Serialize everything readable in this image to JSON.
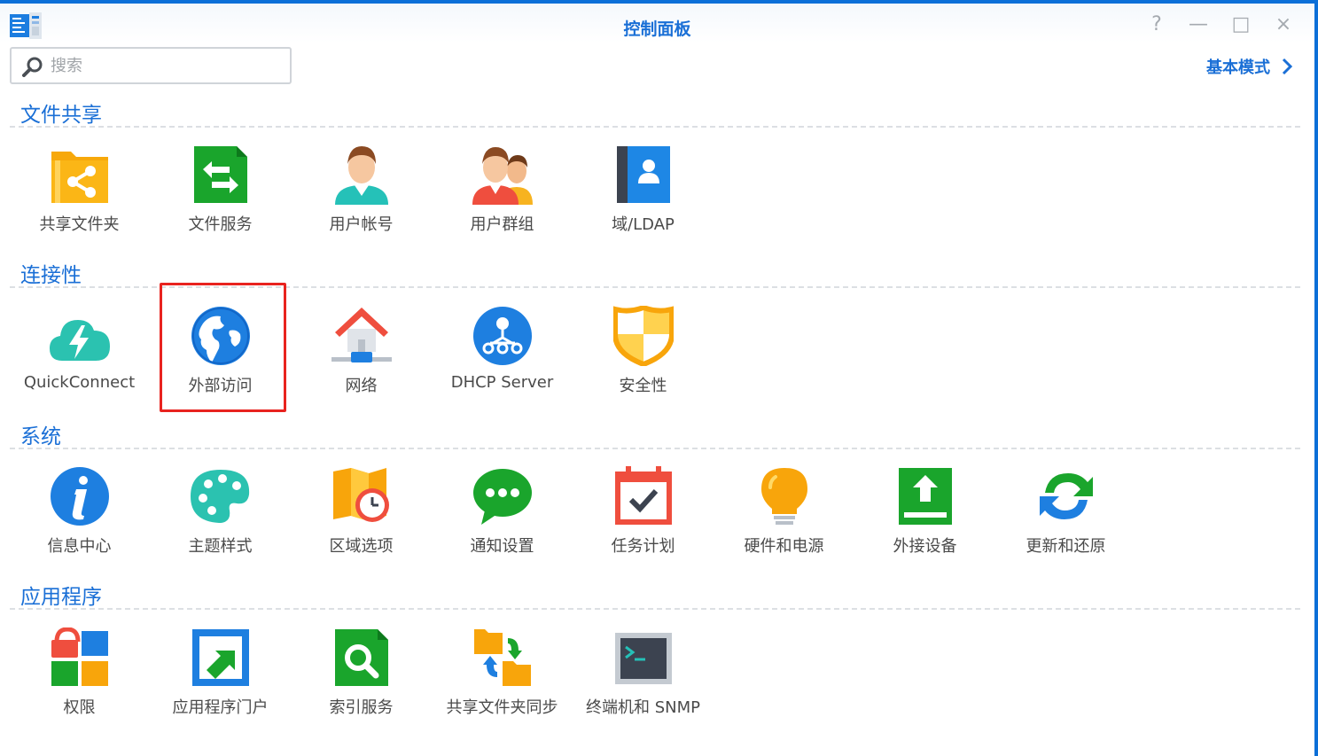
{
  "window": {
    "title": "控制面板",
    "buttons": {
      "help": "?",
      "minimize": "—",
      "maximize": "□",
      "close": "×"
    }
  },
  "search": {
    "placeholder": "搜索",
    "value": ""
  },
  "mode_link": {
    "label": "基本模式"
  },
  "colors": {
    "accent": "#1a6fd6",
    "highlight": "#e8231f",
    "title_bar_stripe": "#0b6fd8"
  },
  "sections": [
    {
      "title": "文件共享",
      "items": [
        {
          "label": "共享文件夹",
          "icon": "shared-folder-icon"
        },
        {
          "label": "文件服务",
          "icon": "file-services-icon"
        },
        {
          "label": "用户帐号",
          "icon": "user-icon"
        },
        {
          "label": "用户群组",
          "icon": "group-icon"
        },
        {
          "label": "域/LDAP",
          "icon": "domain-ldap-icon"
        }
      ]
    },
    {
      "title": "连接性",
      "items": [
        {
          "label": "QuickConnect",
          "icon": "quickconnect-icon"
        },
        {
          "label": "外部访问",
          "icon": "globe-icon",
          "highlighted": true
        },
        {
          "label": "网络",
          "icon": "network-icon"
        },
        {
          "label": "DHCP Server",
          "icon": "dhcp-server-icon"
        },
        {
          "label": "安全性",
          "icon": "shield-icon"
        }
      ]
    },
    {
      "title": "系统",
      "items": [
        {
          "label": "信息中心",
          "icon": "info-icon"
        },
        {
          "label": "主题样式",
          "icon": "palette-icon"
        },
        {
          "label": "区域选项",
          "icon": "regional-options-icon"
        },
        {
          "label": "通知设置",
          "icon": "notification-icon"
        },
        {
          "label": "任务计划",
          "icon": "calendar-task-icon"
        },
        {
          "label": "硬件和电源",
          "icon": "lightbulb-icon"
        },
        {
          "label": "外接设备",
          "icon": "external-device-icon"
        },
        {
          "label": "更新和还原",
          "icon": "update-restore-icon"
        }
      ]
    },
    {
      "title": "应用程序",
      "items": [
        {
          "label": "权限",
          "icon": "privileges-icon"
        },
        {
          "label": "应用程序门户",
          "icon": "app-portal-icon"
        },
        {
          "label": "索引服务",
          "icon": "indexing-service-icon"
        },
        {
          "label": "共享文件夹同步",
          "icon": "shared-folder-sync-icon"
        },
        {
          "label": "终端机和 SNMP",
          "icon": "terminal-icon"
        }
      ]
    }
  ]
}
